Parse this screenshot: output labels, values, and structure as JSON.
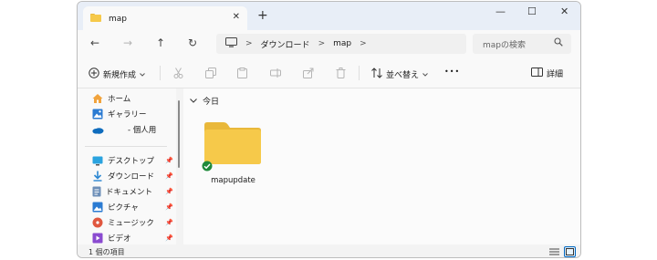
{
  "tab": {
    "title": "map",
    "close": "✕",
    "new_tab": "+"
  },
  "window": {
    "minimize": "—",
    "maximize": "☐",
    "close": "✕"
  },
  "nav": {
    "back": "←",
    "forward": "→",
    "up": "↑",
    "refresh": "↻"
  },
  "address": {
    "segments": [
      "ダウンロード",
      "map"
    ],
    "sep": ">"
  },
  "search": {
    "placeholder": "mapの検索"
  },
  "toolbar": {
    "new_label": "新規作成",
    "sort_label": "並べ替え",
    "more": "•••",
    "details_label": "詳細"
  },
  "sidebar": {
    "top": [
      {
        "label": "ホーム",
        "icon": "home-icon"
      },
      {
        "label": "ギャラリー",
        "icon": "gallery-icon"
      },
      {
        "label": "- 個人用",
        "icon": "onedrive-icon"
      }
    ],
    "pinned": [
      {
        "label": "デスクトップ",
        "icon": "desktop-icon"
      },
      {
        "label": "ダウンロード",
        "icon": "download-icon"
      },
      {
        "label": "ドキュメント",
        "icon": "document-icon"
      },
      {
        "label": "ピクチャ",
        "icon": "pictures-icon"
      },
      {
        "label": "ミュージック",
        "icon": "music-icon"
      },
      {
        "label": "ビデオ",
        "icon": "video-icon"
      }
    ]
  },
  "content": {
    "group_header": "今日",
    "items": [
      {
        "name": "mapupdate",
        "type": "folder",
        "sync_status": "available-offline"
      }
    ]
  },
  "status": {
    "count_text": "1 個の項目"
  },
  "colors": {
    "folder": "#f6c94a",
    "folder_back": "#e9b83a",
    "accent": "#0067c0",
    "sync_green": "#1f8a3b"
  }
}
